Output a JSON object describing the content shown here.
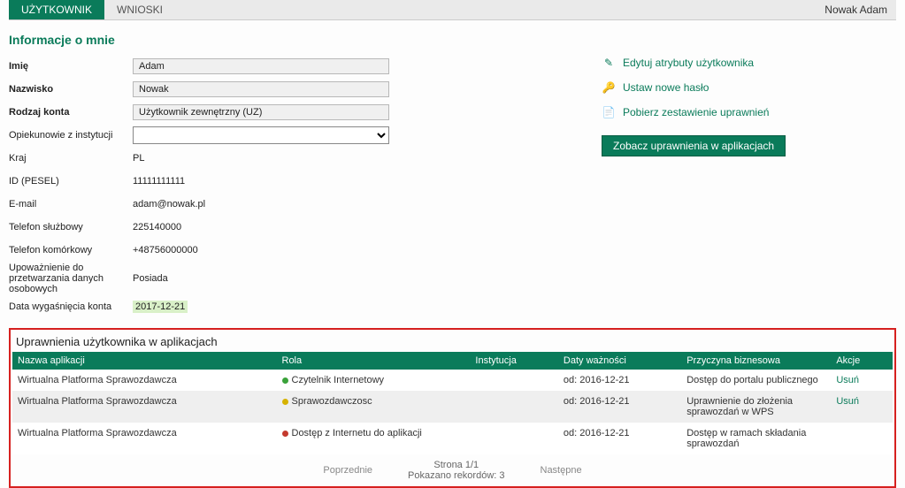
{
  "topbar": {
    "tabs": {
      "user": "UŻYTKOWNIK",
      "requests": "WNIOSKI"
    },
    "current_user": "Nowak Adam"
  },
  "page_title": "Informacje o mnie",
  "info": {
    "labels": {
      "first_name": "Imię",
      "last_name": "Nazwisko",
      "account_type": "Rodzaj konta",
      "guardians": "Opiekunowie z instytucji",
      "country": "Kraj",
      "pesel": "ID (PESEL)",
      "email": "E-mail",
      "phone_work": "Telefon służbowy",
      "phone_mobile": "Telefon komórkowy",
      "consent": "Upoważnienie do przetwarzania danych osobowych",
      "expiry": "Data wygaśnięcia konta"
    },
    "values": {
      "first_name": "Adam",
      "last_name": "Nowak",
      "account_type": "Użytkownik zewnętrzny (UZ)",
      "guardians": "",
      "country": "PL",
      "pesel": "11111111111",
      "email": "adam@nowak.pl",
      "phone_work": "225140000",
      "phone_mobile": "+48756000000",
      "consent": "Posiada",
      "expiry": "2017-12-21"
    }
  },
  "side": {
    "edit_attrs": "Edytuj atrybuty użytkownika",
    "set_password": "Ustaw nowe hasło",
    "download_perms": "Pobierz zestawienie uprawnień",
    "view_perms_btn": "Zobacz uprawnienia w aplikacjach"
  },
  "perms": {
    "title": "Uprawnienia użytkownika w aplikacjach",
    "headers": {
      "app": "Nazwa aplikacji",
      "role": "Rola",
      "institution": "Instytucja",
      "dates": "Daty ważności",
      "reason": "Przyczyna biznesowa",
      "actions": "Akcje"
    },
    "rows": [
      {
        "app": "Wirtualna Platforma Sprawozdawcza",
        "role": "Czytelnik Internetowy",
        "dot": "green",
        "institution": "",
        "dates": "od: 2016-12-21",
        "reason": "Dostęp do portalu publicznego",
        "action": "Usuń"
      },
      {
        "app": "Wirtualna Platforma Sprawozdawcza",
        "role": "Sprawozdawczosc",
        "dot": "yellow",
        "institution": "",
        "dates": "od: 2016-12-21",
        "reason": "Uprawnienie do złożenia sprawozdań w WPS",
        "action": "Usuń"
      },
      {
        "app": "Wirtualna Platforma Sprawozdawcza",
        "role": "Dostęp z Internetu do aplikacji",
        "dot": "red",
        "institution": "",
        "dates": "od: 2016-12-21",
        "reason": "Dostęp w ramach składania sprawozdań",
        "action": ""
      }
    ],
    "pager": {
      "prev": "Poprzednie",
      "page": "Strona 1/1",
      "shown": "Pokazano rekordów: 3",
      "next": "Następne"
    }
  }
}
